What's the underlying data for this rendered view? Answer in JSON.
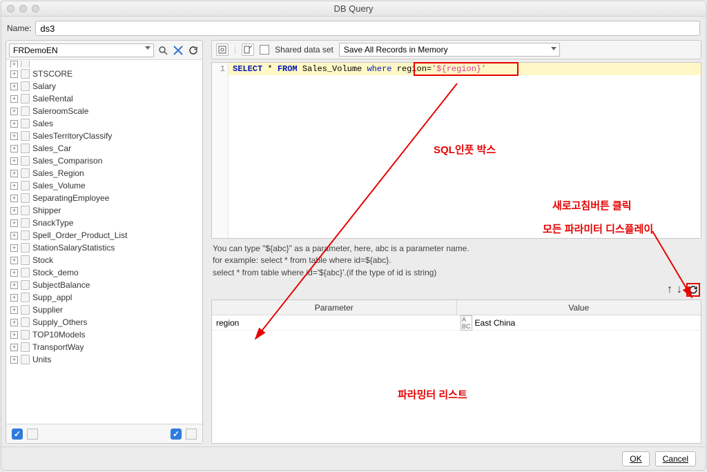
{
  "window": {
    "title": "DB Query"
  },
  "name": {
    "label": "Name:",
    "value": "ds3"
  },
  "datasource": {
    "selected": "FRDemoEN"
  },
  "tree": [
    "STSCORE",
    "Salary",
    "SaleRental",
    "SaleroomScale",
    "Sales",
    "SalesTerritoryClassify",
    "Sales_Car",
    "Sales_Comparison",
    "Sales_Region",
    "Sales_Volume",
    "SeparatingEmployee",
    "Shipper",
    "SnackType",
    "Spell_Order_Product_List",
    "StationSalaryStatistics",
    "Stock",
    "Stock_demo",
    "SubjectBalance",
    "Supp_appl",
    "Supplier",
    "Supply_Others",
    "TOP10Models",
    "TransportWay",
    "Units"
  ],
  "toolbar": {
    "shared_label": "Shared data set",
    "save_mode": "Save All Records in Memory"
  },
  "sql": {
    "line_no": "1",
    "select": "SELECT",
    "star": "*",
    "from": "FROM",
    "table": "Sales_Volume",
    "where": "where",
    "region_eq": "region=",
    "str": "'${region}'"
  },
  "hint": {
    "l1": "You can type \"${abc}\" as a parameter, here, abc is a parameter name.",
    "l2": "for example: select * from table where id=${abc}.",
    "l3": "select * from table where id='${abc}'.(if the type of id is string)"
  },
  "param_table": {
    "col_param": "Parameter",
    "col_value": "Value",
    "row1_param": "region",
    "row1_value": "East China"
  },
  "annotations": {
    "sql_box": "SQL인풋 박스",
    "refresh1": "새로고침버튼 클릭",
    "refresh2": "모든 파라미터 디스플레이",
    "param_list": "파라밍터 리스트"
  },
  "footer": {
    "ok": "OK",
    "cancel": "Cancel"
  }
}
